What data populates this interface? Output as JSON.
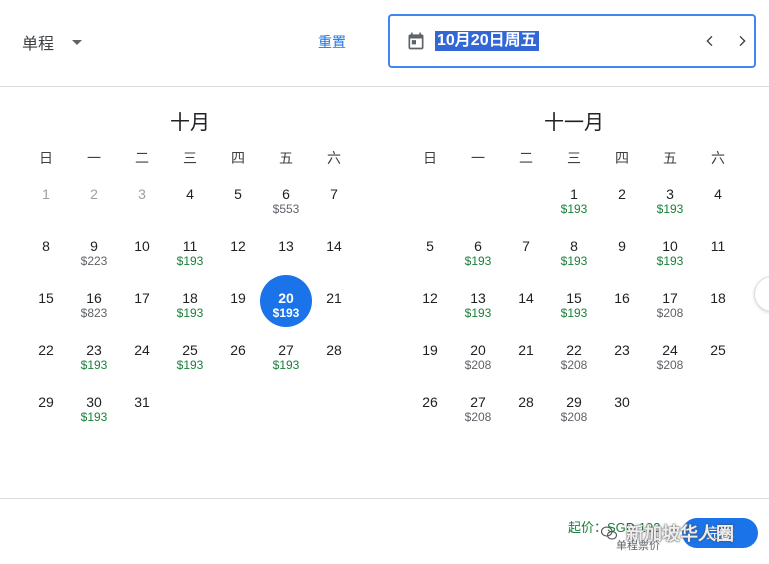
{
  "header": {
    "trip_type": "单程",
    "reset_label": "重置",
    "selected_date": "10月20日周五"
  },
  "weekdays": [
    "日",
    "一",
    "二",
    "三",
    "四",
    "五",
    "六"
  ],
  "months": [
    {
      "title": "十月",
      "days": [
        {
          "d": "1",
          "p": "",
          "past": true
        },
        {
          "d": "2",
          "p": "",
          "past": true
        },
        {
          "d": "3",
          "p": "",
          "past": true
        },
        {
          "d": "4",
          "p": ""
        },
        {
          "d": "5",
          "p": ""
        },
        {
          "d": "6",
          "p": "$553"
        },
        {
          "d": "7",
          "p": ""
        },
        {
          "d": "8",
          "p": ""
        },
        {
          "d": "9",
          "p": "$223"
        },
        {
          "d": "10",
          "p": ""
        },
        {
          "d": "11",
          "p": "$193",
          "low": true
        },
        {
          "d": "12",
          "p": ""
        },
        {
          "d": "13",
          "p": ""
        },
        {
          "d": "14",
          "p": ""
        },
        {
          "d": "15",
          "p": ""
        },
        {
          "d": "16",
          "p": "$823"
        },
        {
          "d": "17",
          "p": ""
        },
        {
          "d": "18",
          "p": "$193",
          "low": true
        },
        {
          "d": "19",
          "p": ""
        },
        {
          "d": "20",
          "p": "$193",
          "low": true,
          "selected": true
        },
        {
          "d": "21",
          "p": ""
        },
        {
          "d": "22",
          "p": ""
        },
        {
          "d": "23",
          "p": "$193",
          "low": true
        },
        {
          "d": "24",
          "p": ""
        },
        {
          "d": "25",
          "p": "$193",
          "low": true
        },
        {
          "d": "26",
          "p": ""
        },
        {
          "d": "27",
          "p": "$193",
          "low": true
        },
        {
          "d": "28",
          "p": ""
        },
        {
          "d": "29",
          "p": ""
        },
        {
          "d": "30",
          "p": "$193",
          "low": true
        },
        {
          "d": "31",
          "p": ""
        }
      ],
      "offset": 0
    },
    {
      "title": "十一月",
      "days": [
        {
          "d": "1",
          "p": "$193",
          "low": true
        },
        {
          "d": "2",
          "p": ""
        },
        {
          "d": "3",
          "p": "$193",
          "low": true
        },
        {
          "d": "4",
          "p": ""
        },
        {
          "d": "5",
          "p": ""
        },
        {
          "d": "6",
          "p": "$193",
          "low": true
        },
        {
          "d": "7",
          "p": ""
        },
        {
          "d": "8",
          "p": "$193",
          "low": true
        },
        {
          "d": "9",
          "p": ""
        },
        {
          "d": "10",
          "p": "$193",
          "low": true
        },
        {
          "d": "11",
          "p": ""
        },
        {
          "d": "12",
          "p": ""
        },
        {
          "d": "13",
          "p": "$193",
          "low": true
        },
        {
          "d": "14",
          "p": ""
        },
        {
          "d": "15",
          "p": "$193",
          "low": true
        },
        {
          "d": "16",
          "p": ""
        },
        {
          "d": "17",
          "p": "$208"
        },
        {
          "d": "18",
          "p": ""
        },
        {
          "d": "19",
          "p": ""
        },
        {
          "d": "20",
          "p": "$208"
        },
        {
          "d": "21",
          "p": ""
        },
        {
          "d": "22",
          "p": "$208"
        },
        {
          "d": "23",
          "p": ""
        },
        {
          "d": "24",
          "p": "$208"
        },
        {
          "d": "25",
          "p": ""
        },
        {
          "d": "26",
          "p": ""
        },
        {
          "d": "27",
          "p": "$208"
        },
        {
          "d": "28",
          "p": ""
        },
        {
          "d": "29",
          "p": "$208"
        },
        {
          "d": "30",
          "p": ""
        }
      ],
      "offset": 3
    }
  ],
  "footer": {
    "price_text": "起价：SGD 193",
    "sub_text": "单程票价",
    "done_label": "完成"
  },
  "watermark": "新加坡华人圈",
  "colors": {
    "accent": "#1a73e8",
    "low_price": "#188038",
    "selection_highlight": "#3367d6"
  }
}
